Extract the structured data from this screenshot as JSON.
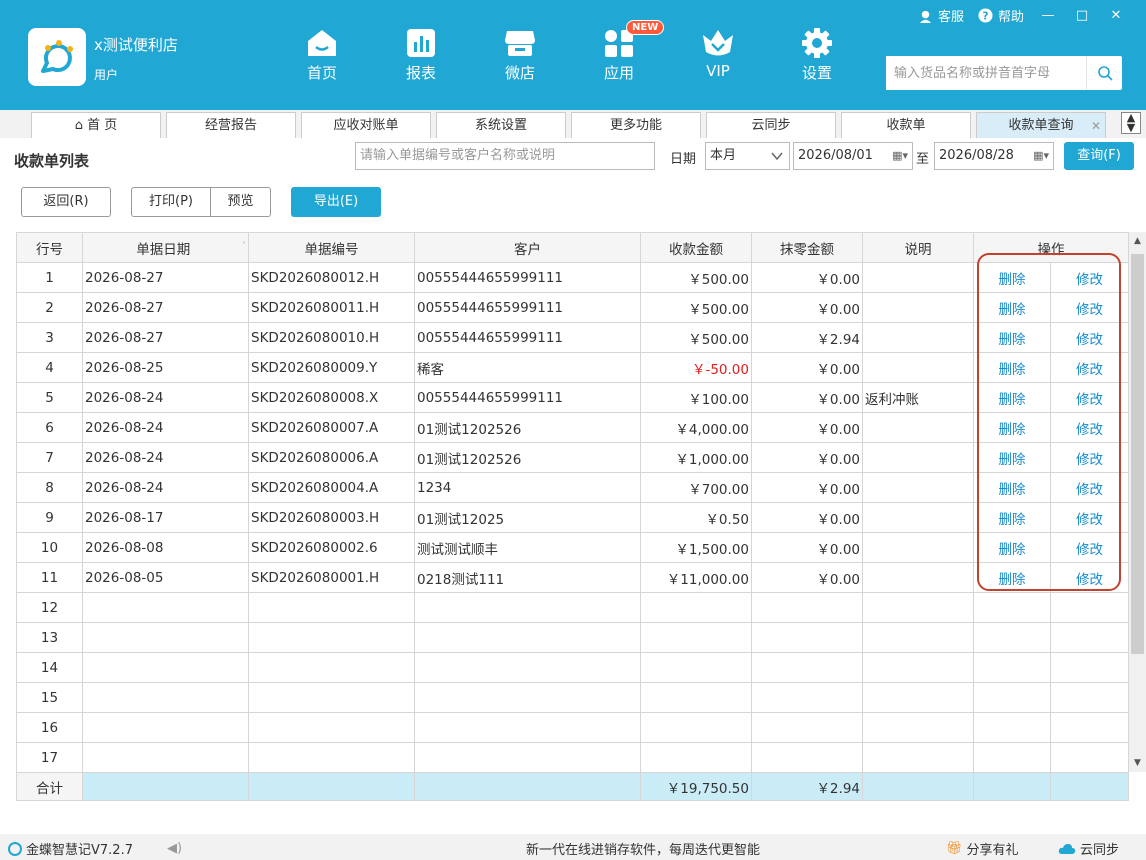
{
  "header": {
    "store_name": "x测试便利店",
    "store_role": "用户",
    "nav": [
      {
        "label": "首页",
        "icon": "home-icon"
      },
      {
        "label": "报表",
        "icon": "bar-chart-icon"
      },
      {
        "label": "微店",
        "icon": "shop-icon"
      },
      {
        "label": "应用",
        "icon": "apps-icon",
        "badge": "NEW"
      },
      {
        "label": "VIP",
        "icon": "vip-crown-icon"
      },
      {
        "label": "设置",
        "icon": "gear-icon"
      }
    ],
    "service_label": "客服",
    "help_label": "帮助",
    "search_placeholder": "输入货品名称或拼音首字母"
  },
  "tabs": [
    {
      "label": "首 页",
      "icon": "home-icon"
    },
    {
      "label": "经营报告"
    },
    {
      "label": "应收对账单"
    },
    {
      "label": "系统设置"
    },
    {
      "label": "更多功能"
    },
    {
      "label": "云同步"
    },
    {
      "label": "收款单"
    },
    {
      "label": "收款单查询",
      "active": true
    }
  ],
  "filter": {
    "title": "收款单列表",
    "keyword_placeholder": "请输入单据编号或客户名称或说明",
    "date_label": "日期",
    "period": "本月",
    "date_from": "2026/08/01",
    "to_label": "至",
    "date_to": "2026/08/28",
    "query_label": "查询(F)"
  },
  "actions": {
    "back_label": "返回(R)",
    "print_label": "打印(P)",
    "preview_label": "预览",
    "export_label": "导出(E)"
  },
  "table": {
    "columns": [
      "行号",
      "单据日期",
      "单据编号",
      "客户",
      "收款金额",
      "抹零金额",
      "说明",
      "操作"
    ],
    "delete_label": "删除",
    "edit_label": "修改",
    "rows": [
      {
        "no": "1",
        "date": "2026-08-27",
        "code": "SKD2026080012.H",
        "customer": "00555444655999111",
        "amount": "￥500.00",
        "round_off": "￥0.00",
        "note": ""
      },
      {
        "no": "2",
        "date": "2026-08-27",
        "code": "SKD2026080011.H",
        "customer": "00555444655999111",
        "amount": "￥500.00",
        "round_off": "￥0.00",
        "note": ""
      },
      {
        "no": "3",
        "date": "2026-08-27",
        "code": "SKD2026080010.H",
        "customer": "00555444655999111",
        "amount": "￥500.00",
        "round_off": "￥2.94",
        "note": ""
      },
      {
        "no": "4",
        "date": "2026-08-25",
        "code": "SKD2026080009.Y",
        "customer": "稀客",
        "amount": "￥-50.00",
        "round_off": "￥0.00",
        "note": "",
        "negative": true
      },
      {
        "no": "5",
        "date": "2026-08-24",
        "code": "SKD2026080008.X",
        "customer": "00555444655999111",
        "amount": "￥100.00",
        "round_off": "￥0.00",
        "note": "返利冲账"
      },
      {
        "no": "6",
        "date": "2026-08-24",
        "code": "SKD2026080007.A",
        "customer": "01测试1202526",
        "amount": "￥4,000.00",
        "round_off": "￥0.00",
        "note": ""
      },
      {
        "no": "7",
        "date": "2026-08-24",
        "code": "SKD2026080006.A",
        "customer": "01测试1202526",
        "amount": "￥1,000.00",
        "round_off": "￥0.00",
        "note": ""
      },
      {
        "no": "8",
        "date": "2026-08-24",
        "code": "SKD2026080004.A",
        "customer": "1234",
        "amount": "￥700.00",
        "round_off": "￥0.00",
        "note": ""
      },
      {
        "no": "9",
        "date": "2026-08-17",
        "code": "SKD2026080003.H",
        "customer": "01测试12025",
        "amount": "￥0.50",
        "round_off": "￥0.00",
        "note": ""
      },
      {
        "no": "10",
        "date": "2026-08-08",
        "code": "SKD2026080002.6",
        "customer": "测试测试顺丰",
        "amount": "￥1,500.00",
        "round_off": "￥0.00",
        "note": ""
      },
      {
        "no": "11",
        "date": "2026-08-05",
        "code": "SKD2026080001.H",
        "customer": "0218测试111",
        "amount": "￥11,000.00",
        "round_off": "￥0.00",
        "note": ""
      }
    ],
    "empty_rows": [
      "12",
      "13",
      "14",
      "15",
      "16",
      "17"
    ],
    "total_label": "合计",
    "total_amount": "￥19,750.50",
    "total_round_off": "￥2.94"
  },
  "status": {
    "version": "金蝶智慧记V7.2.7",
    "slogan": "新一代在线进销存软件，每周迭代更智能",
    "share_label": "分享有礼",
    "sync_label": "云同步"
  },
  "colors": {
    "accent": "#20a7d4",
    "negative": "#e0201b",
    "highlight": "#c0432f"
  }
}
